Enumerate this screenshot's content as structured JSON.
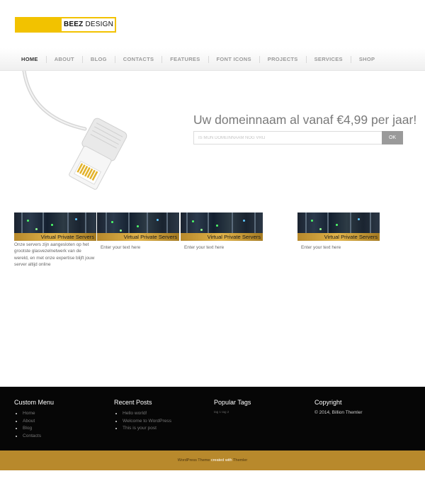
{
  "logo": {
    "brand_bold": "BEEZ",
    "brand_rest": "DESIGN"
  },
  "nav": {
    "items": [
      "HOME",
      "ABOUT",
      "BLOG",
      "CONTACTS",
      "FEATURES",
      "FONT ICONS",
      "PROJECTS",
      "SERVICES",
      "SHOP"
    ]
  },
  "hero": {
    "title": "Uw domeinnaam al vanaf €4,99 per jaar!",
    "input_placeholder": "IS MIJN DOMEINNAAM NOG VRIJ",
    "button_label": "OK"
  },
  "cards": [
    {
      "caption": "Virtual Private Servers",
      "text": "Onze servers zijn aangesloten op het grootste glasvezelnetwerk van de wereld, en met onze expertise blijft jouw server altijd online"
    },
    {
      "caption": "Virtual Private Servers",
      "text": "Enter your text here"
    },
    {
      "caption": "Virtual Private Servers",
      "text": "Enter your text here"
    },
    {
      "caption": "Virtual Private Servers",
      "text": "Enter your text here"
    }
  ],
  "footer": {
    "custom_menu": {
      "title": "Custom Menu",
      "items": [
        "Home",
        "About",
        "Blog",
        "Contacts"
      ]
    },
    "recent_posts": {
      "title": "Recent Posts",
      "items": [
        "Hello world!",
        "Welcome to WordPress",
        "This is your post"
      ]
    },
    "popular_tags": {
      "title": "Popular Tags",
      "tags": "tag 1 tag 2"
    },
    "copyright": {
      "title": "Copyright",
      "text": "© 2014, Billion Themler"
    }
  },
  "bottom_bar": {
    "part1": "WordPress Theme",
    "part2": " created with ",
    "part3": "Themler"
  },
  "colors": {
    "accent": "#f2c200",
    "gold_band": "#b8892c",
    "footer_bg": "#060606"
  }
}
